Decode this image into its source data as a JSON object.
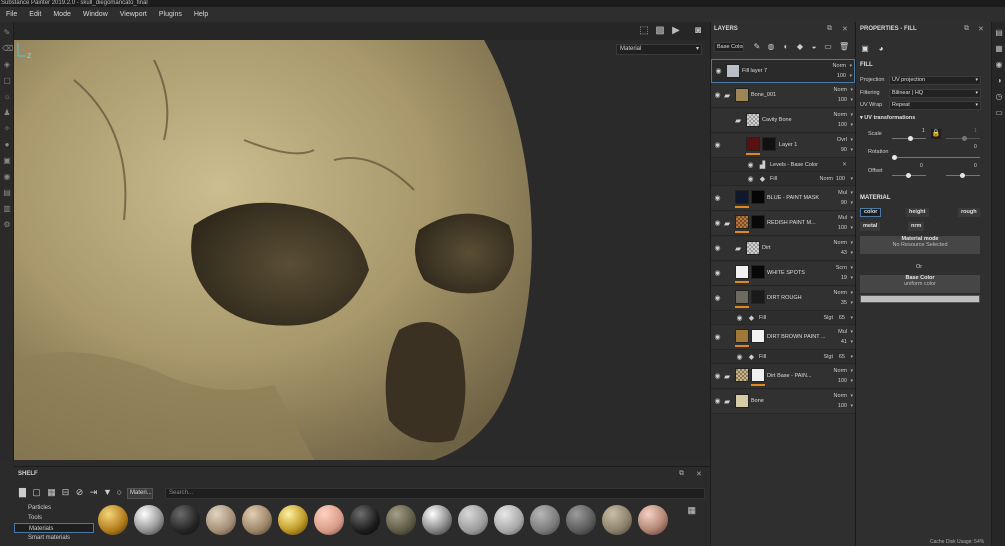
{
  "window": {
    "title": "Substance Painter 2019.2.0 - skull_diegomancato_final"
  },
  "menu": [
    "File",
    "Edit",
    "Mode",
    "Window",
    "Viewport",
    "Plugins",
    "Help"
  ],
  "viewport": {
    "mode_select": "Material"
  },
  "shelf": {
    "title": "SHELF",
    "filter_chip": "Materi...",
    "search_placeholder": "Search...",
    "categories": [
      "Particles",
      "Tools",
      "Materials",
      "Smart materials"
    ],
    "active_category": "Materials"
  },
  "layers": {
    "title": "LAYERS",
    "channel_select": "Base Color",
    "rows": [
      {
        "name": "Fill layer 7",
        "blend": "Norm",
        "opacity": "100"
      },
      {
        "name": "Bone_001",
        "blend": "Norm",
        "opacity": "100"
      },
      {
        "name": "Cavity Bone",
        "blend": "Norm",
        "opacity": "100"
      },
      {
        "name": "Layer 1",
        "blend": "Ovrl",
        "opacity": "90"
      },
      {
        "name": "Levels - Base Color"
      },
      {
        "name": "Fill",
        "blend": "Norm",
        "opacity": "100"
      },
      {
        "name": "BLUE - PAINT MASK",
        "blend": "Mul",
        "opacity": "90"
      },
      {
        "name": "REDISH PAINT M...",
        "blend": "Mul",
        "opacity": "100"
      },
      {
        "name": "Dirt",
        "blend": "Norm",
        "opacity": "43"
      },
      {
        "name": "WHITE SPOTS",
        "blend": "Scrn",
        "opacity": "19"
      },
      {
        "name": "DIRT ROUGH",
        "blend": "Norm",
        "opacity": "35"
      },
      {
        "name": "Fill",
        "blend": "Slgt",
        "opacity": "65"
      },
      {
        "name": "DIRT BROWN PAINT ...",
        "blend": "Mul",
        "opacity": "41"
      },
      {
        "name": "Fill",
        "blend": "Slgt",
        "opacity": "65"
      },
      {
        "name": "Dirt Base - PAIN...",
        "blend": "Norm",
        "opacity": "100"
      },
      {
        "name": "Bone",
        "blend": "Norm",
        "opacity": "100"
      }
    ]
  },
  "properties": {
    "title": "PROPERTIES - FILL",
    "fill_section": "FILL",
    "projection_label": "Projection",
    "projection_value": "UV projection",
    "filtering_label": "Filtering",
    "filtering_value": "Bilinear | HQ",
    "uvwrap_label": "UV Wrap",
    "uvwrap_value": "Repeat",
    "uvtrans_title": "UV transformations",
    "scale_label": "Scale",
    "scale_value_a": "1",
    "scale_value_b": "1",
    "rotation_label": "Rotation",
    "rotation_value": "0",
    "offset_label": "Offset",
    "offset_value_a": "0",
    "offset_value_b": "0",
    "material_section": "MATERIAL",
    "channels": [
      "color",
      "height",
      "rough",
      "metal",
      "nrm"
    ],
    "material_mode_title": "Material mode",
    "material_mode_value": "No Resource Selected",
    "or_text": "Or",
    "base_color_title": "Base Color",
    "base_color_value": "uniform color",
    "base_color_swatch": "#c0c0c0"
  },
  "status": {
    "text": "Cache Disk Usage: 54%"
  }
}
